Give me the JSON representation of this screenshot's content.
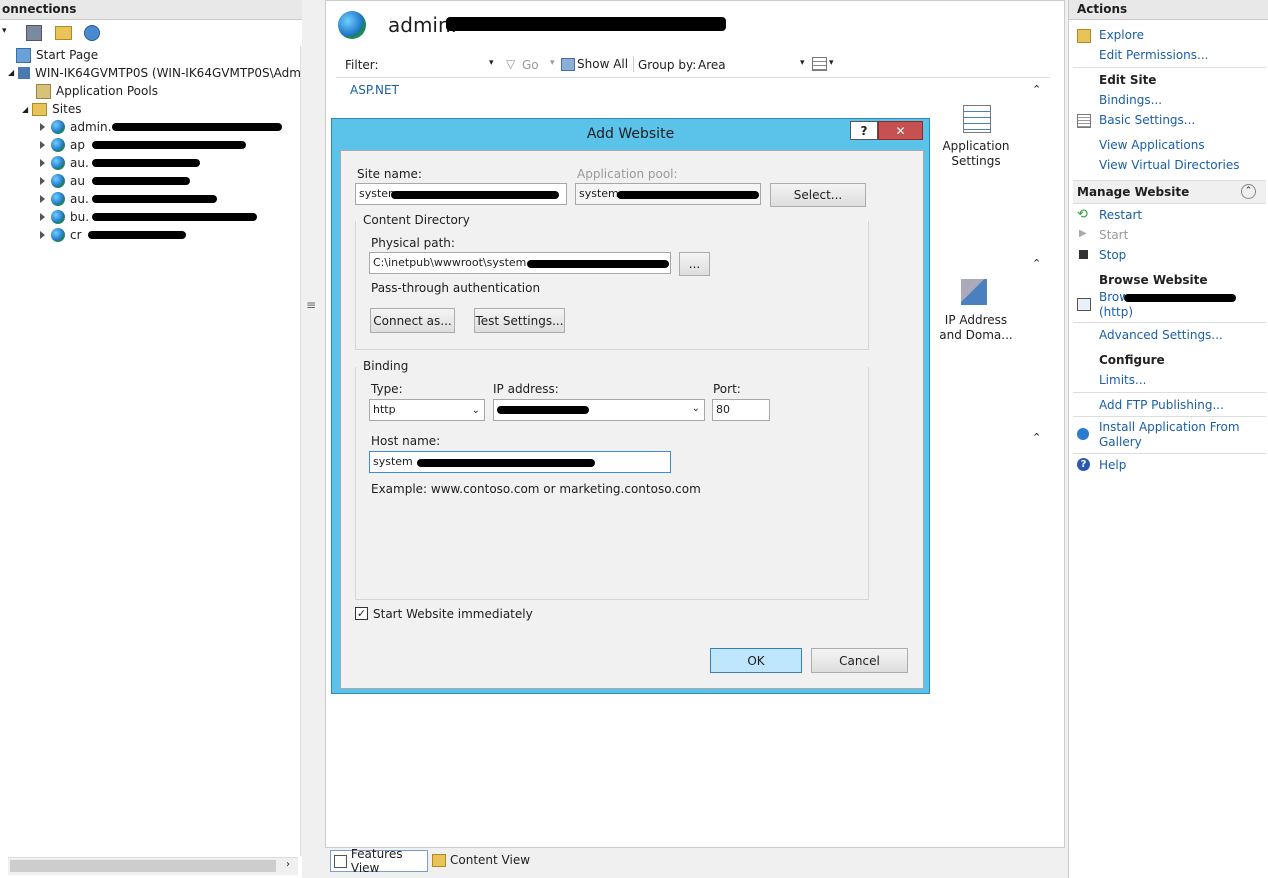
{
  "connections": {
    "title": "onnections",
    "tree": {
      "start_page": "Start Page",
      "server": "WIN-IK64GVMTP0S (WIN-IK64GVMTP0S\\Administ",
      "app_pools": "Application Pools",
      "sites": "Sites",
      "site_items": [
        "admin.",
        "ap",
        "au.",
        "au",
        "au.",
        "bu.",
        "cr"
      ]
    }
  },
  "main": {
    "title": "admin.",
    "filter": {
      "label": "Filter:",
      "go": "Go",
      "show_all": "Show All",
      "group_by_label": "Group by:",
      "group_by_value": "Area"
    },
    "aspnet_label": "ASP.NET",
    "features": {
      "app_settings": "Application\nSettings",
      "ip_address": "IP Address\nand Doma..."
    },
    "bottom_tabs": {
      "features_view": "Features View",
      "content_view": "Content View"
    }
  },
  "dialog": {
    "title": "Add Website",
    "help_button": "?",
    "close_button": "✕",
    "site_name_label": "Site name:",
    "site_name_value": "system",
    "app_pool_label": "Application pool:",
    "app_pool_value": "system",
    "select_button": "Select...",
    "content_directory_label": "Content Directory",
    "physical_path_label": "Physical path:",
    "physical_path_value": "C:\\inetpub\\wwwroot\\system",
    "browse_button": "...",
    "pass_through_label": "Pass-through authentication",
    "connect_as_button": "Connect as...",
    "test_settings_button": "Test Settings...",
    "binding_label": "Binding",
    "type_label": "Type:",
    "type_value": "http",
    "ip_label": "IP address:",
    "port_label": "Port:",
    "port_value": "80",
    "host_label": "Host name:",
    "host_value": "system",
    "example_text": "Example: www.contoso.com or marketing.contoso.com",
    "start_immediately_label": "Start Website immediately",
    "start_immediately_checked": true,
    "ok_button": "OK",
    "cancel_button": "Cancel"
  },
  "actions": {
    "title": "Actions",
    "explore": "Explore",
    "edit_permissions": "Edit Permissions...",
    "edit_site_header": "Edit Site",
    "bindings": "Bindings...",
    "basic_settings": "Basic Settings...",
    "view_applications": "View Applications",
    "view_virtual_directories": "View Virtual Directories",
    "manage_website_header": "Manage Website",
    "restart": "Restart",
    "start": "Start",
    "stop": "Stop",
    "browse_website_header": "Browse Website",
    "browse": "Brow",
    "browse_http": "(http)",
    "advanced_settings": "Advanced Settings...",
    "configure_header": "Configure",
    "limits": "Limits...",
    "add_ftp": "Add FTP Publishing...",
    "install_gallery_1": "Install Application From",
    "install_gallery_2": "Gallery",
    "help": "Help"
  },
  "colors": {
    "dialog_frame": "#5bc3ea",
    "dialog_close": "#c75050",
    "link": "#1a5ea8",
    "ok_button": "#bee6fd"
  }
}
